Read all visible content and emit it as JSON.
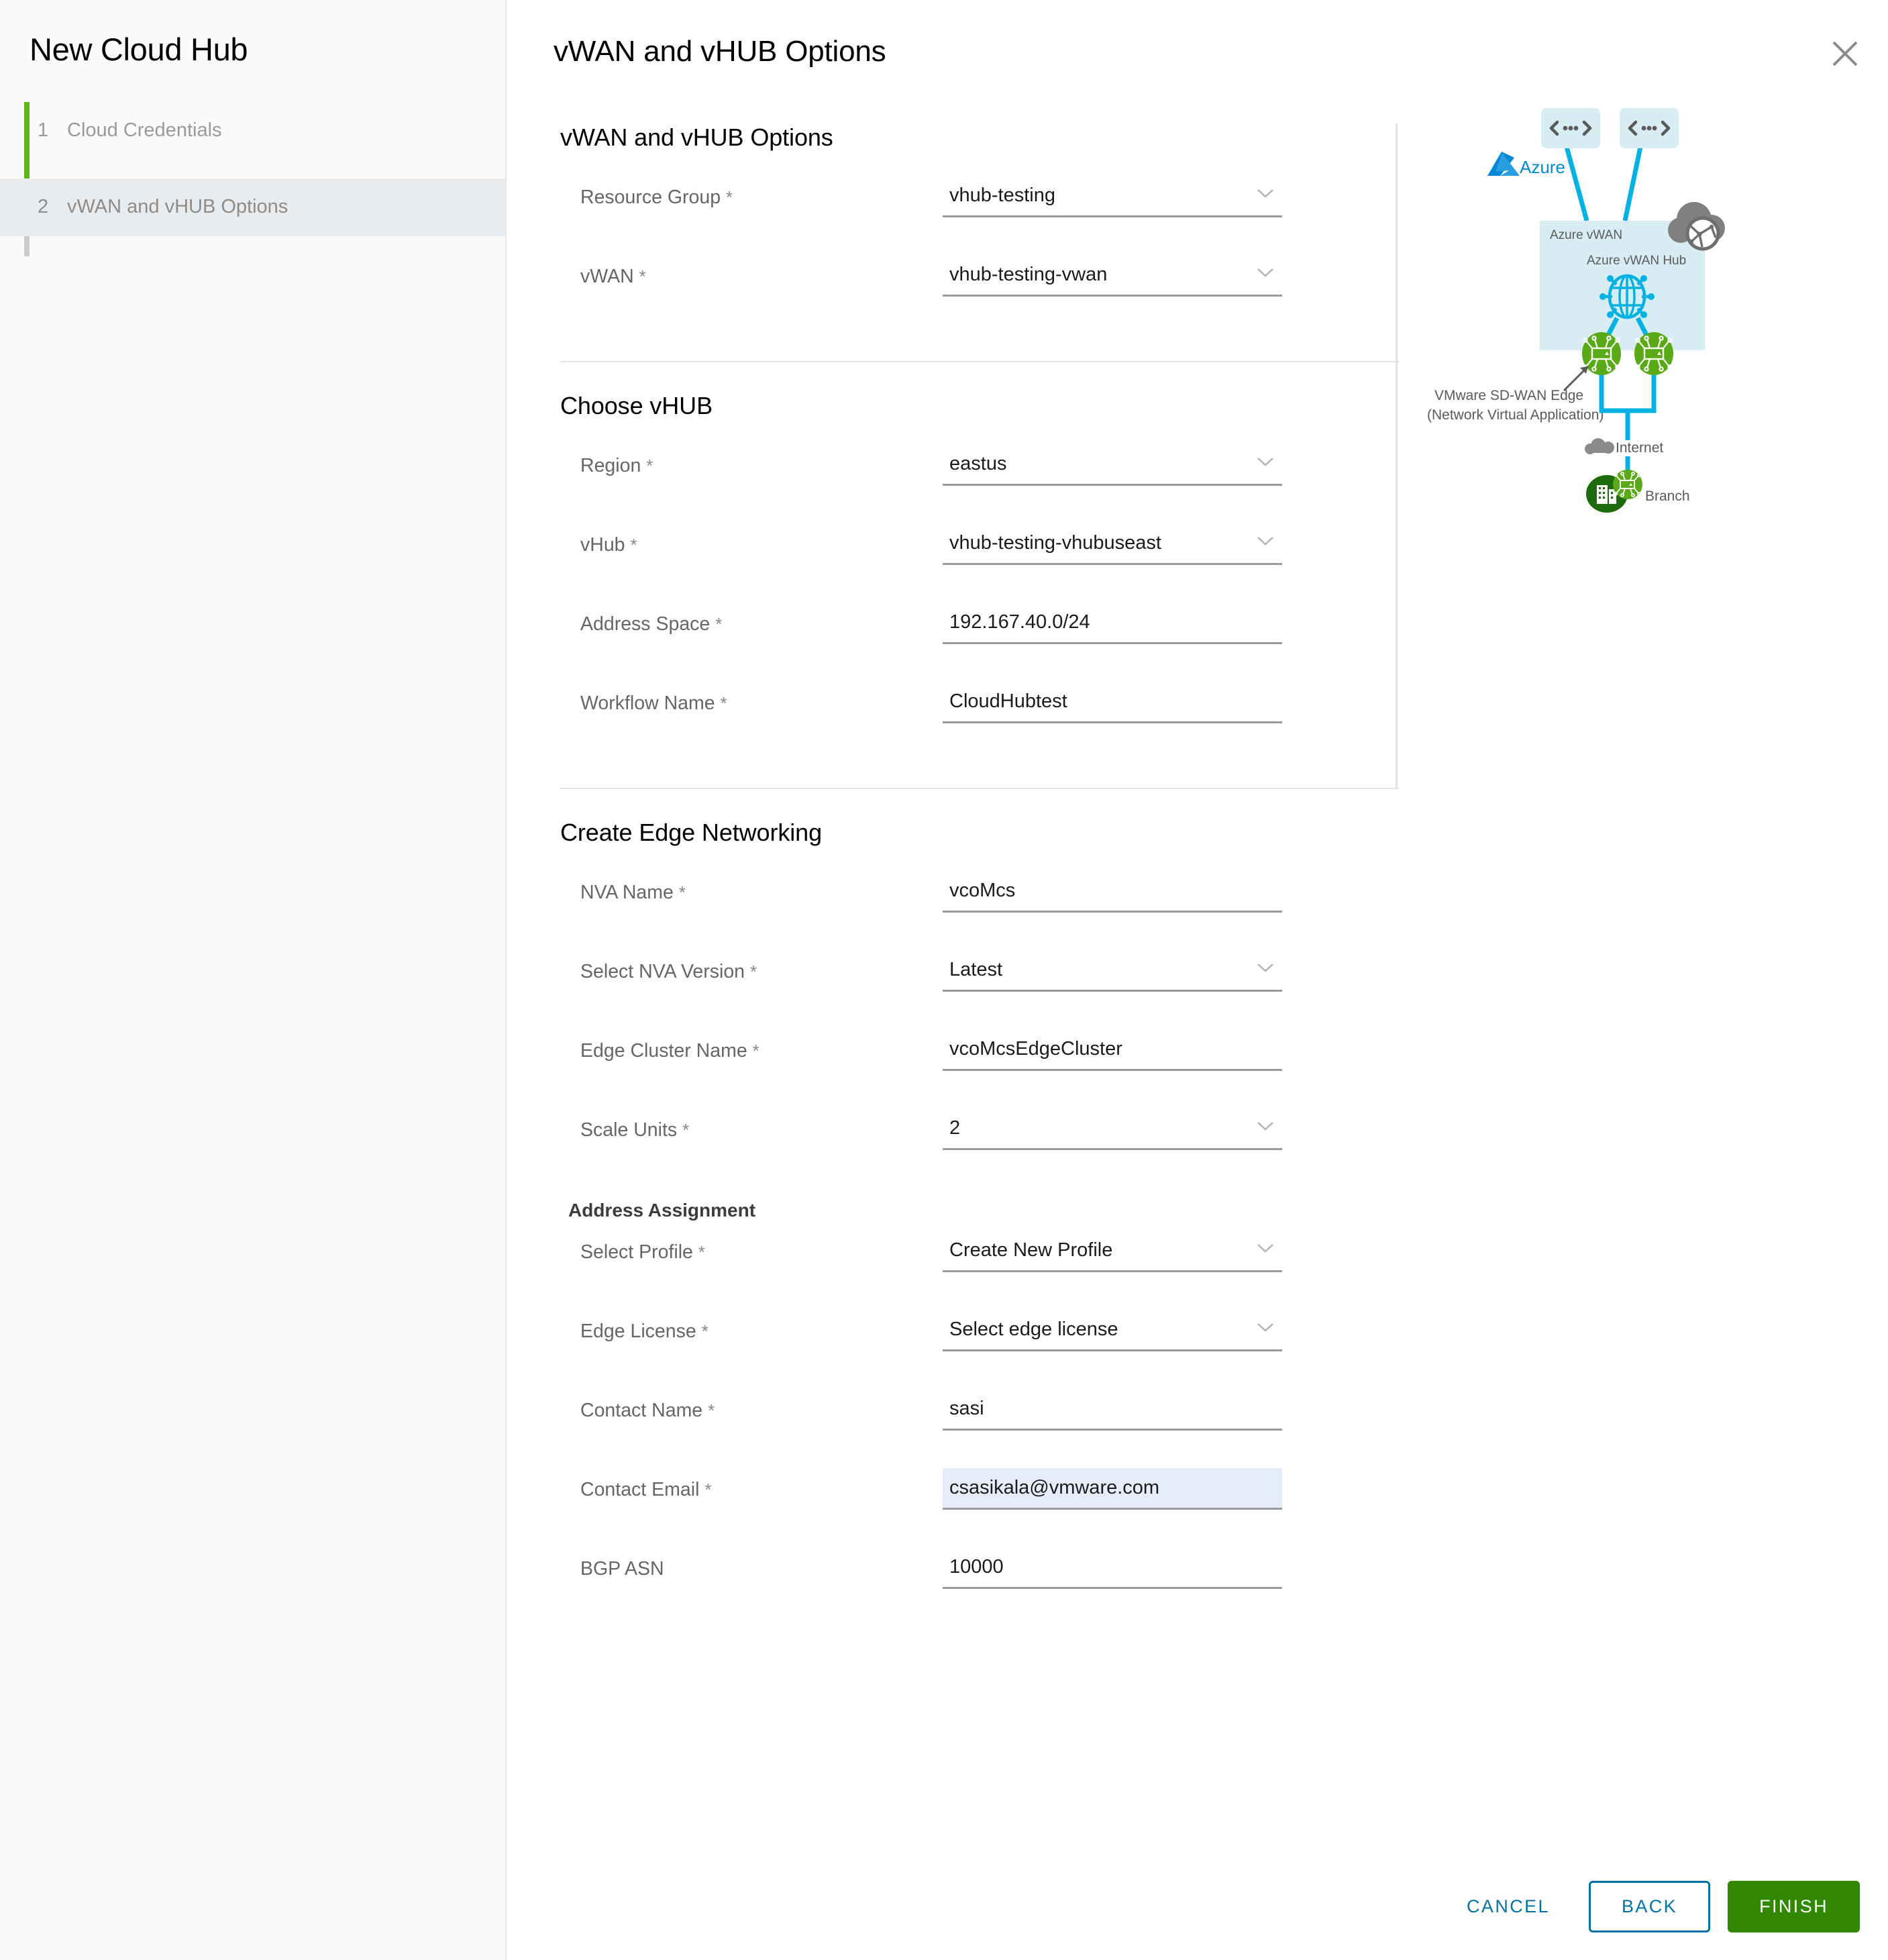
{
  "wizard": {
    "title": "New Cloud Hub",
    "steps": [
      {
        "num": "1",
        "label": "Cloud Credentials"
      },
      {
        "num": "2",
        "label": "vWAN and vHUB Options"
      }
    ]
  },
  "header": {
    "title": "vWAN and vHUB Options",
    "close_icon": "close-icon"
  },
  "sections": {
    "vwan": {
      "title": "vWAN and vHUB Options",
      "fields": [
        {
          "label": "Resource Group",
          "required": "*",
          "value": "vhub-testing",
          "type": "select"
        },
        {
          "label": "vWAN",
          "required": "*",
          "value": "vhub-testing-vwan",
          "type": "select"
        }
      ]
    },
    "vhub": {
      "title": "Choose vHUB",
      "fields": [
        {
          "label": "Region",
          "required": "*",
          "value": "eastus",
          "type": "select"
        },
        {
          "label": "vHub",
          "required": "*",
          "value": "vhub-testing-vhubuseast",
          "type": "select"
        },
        {
          "label": "Address Space",
          "required": "*",
          "value": "192.167.40.0/24",
          "type": "text"
        },
        {
          "label": "Workflow Name",
          "required": "*",
          "value": "CloudHubtest",
          "type": "text"
        }
      ]
    },
    "edge": {
      "title": "Create Edge Networking",
      "fields": [
        {
          "label": "NVA Name",
          "required": "*",
          "value": "vcoMcs",
          "type": "text"
        },
        {
          "label": "Select NVA Version",
          "required": "*",
          "value": "Latest",
          "type": "select"
        },
        {
          "label": "Edge Cluster Name",
          "required": "*",
          "value": "vcoMcsEdgeCluster",
          "type": "text"
        },
        {
          "label": "Scale Units",
          "required": "*",
          "value": "2",
          "type": "select"
        }
      ],
      "subsection_title": "Address Assignment",
      "subsection_fields": [
        {
          "label": "Select Profile",
          "required": "*",
          "value": "Create New Profile",
          "type": "select"
        },
        {
          "label": "Edge License",
          "required": "*",
          "value": "Select edge license",
          "type": "select"
        },
        {
          "label": "Contact Name",
          "required": "*",
          "value": "sasi",
          "type": "text"
        },
        {
          "label": "Contact Email",
          "required": "*",
          "value": "csasikala@vmware.com",
          "type": "text",
          "focused": true
        },
        {
          "label": "BGP ASN",
          "required": "",
          "value": "10000",
          "type": "text"
        }
      ]
    }
  },
  "diagram": {
    "azure_logo_label": "Azure",
    "vwan_box_label": "Azure vWAN",
    "hub_label": "Azure vWAN Hub",
    "nva_label_line1": "VMware SD-WAN Edge",
    "nva_label_line2": "(Network Virtual Application)",
    "internet_label": "Internet",
    "branch_label": "Branch"
  },
  "footer": {
    "cancel_label": "CANCEL",
    "back_label": "BACK",
    "finish_label": "FINISH"
  },
  "colors": {
    "step_active_rail": "#60b515",
    "azure_blue": "#0089d6",
    "link_blue": "#0072a3",
    "finish_green": "#318700",
    "diagram_cyan": "#00b2e3",
    "diagram_box": "#d8ecf3",
    "edge_green": "#5aa917",
    "branch_green": "#1d6b0e",
    "focused_field": "#e7ecfa"
  }
}
